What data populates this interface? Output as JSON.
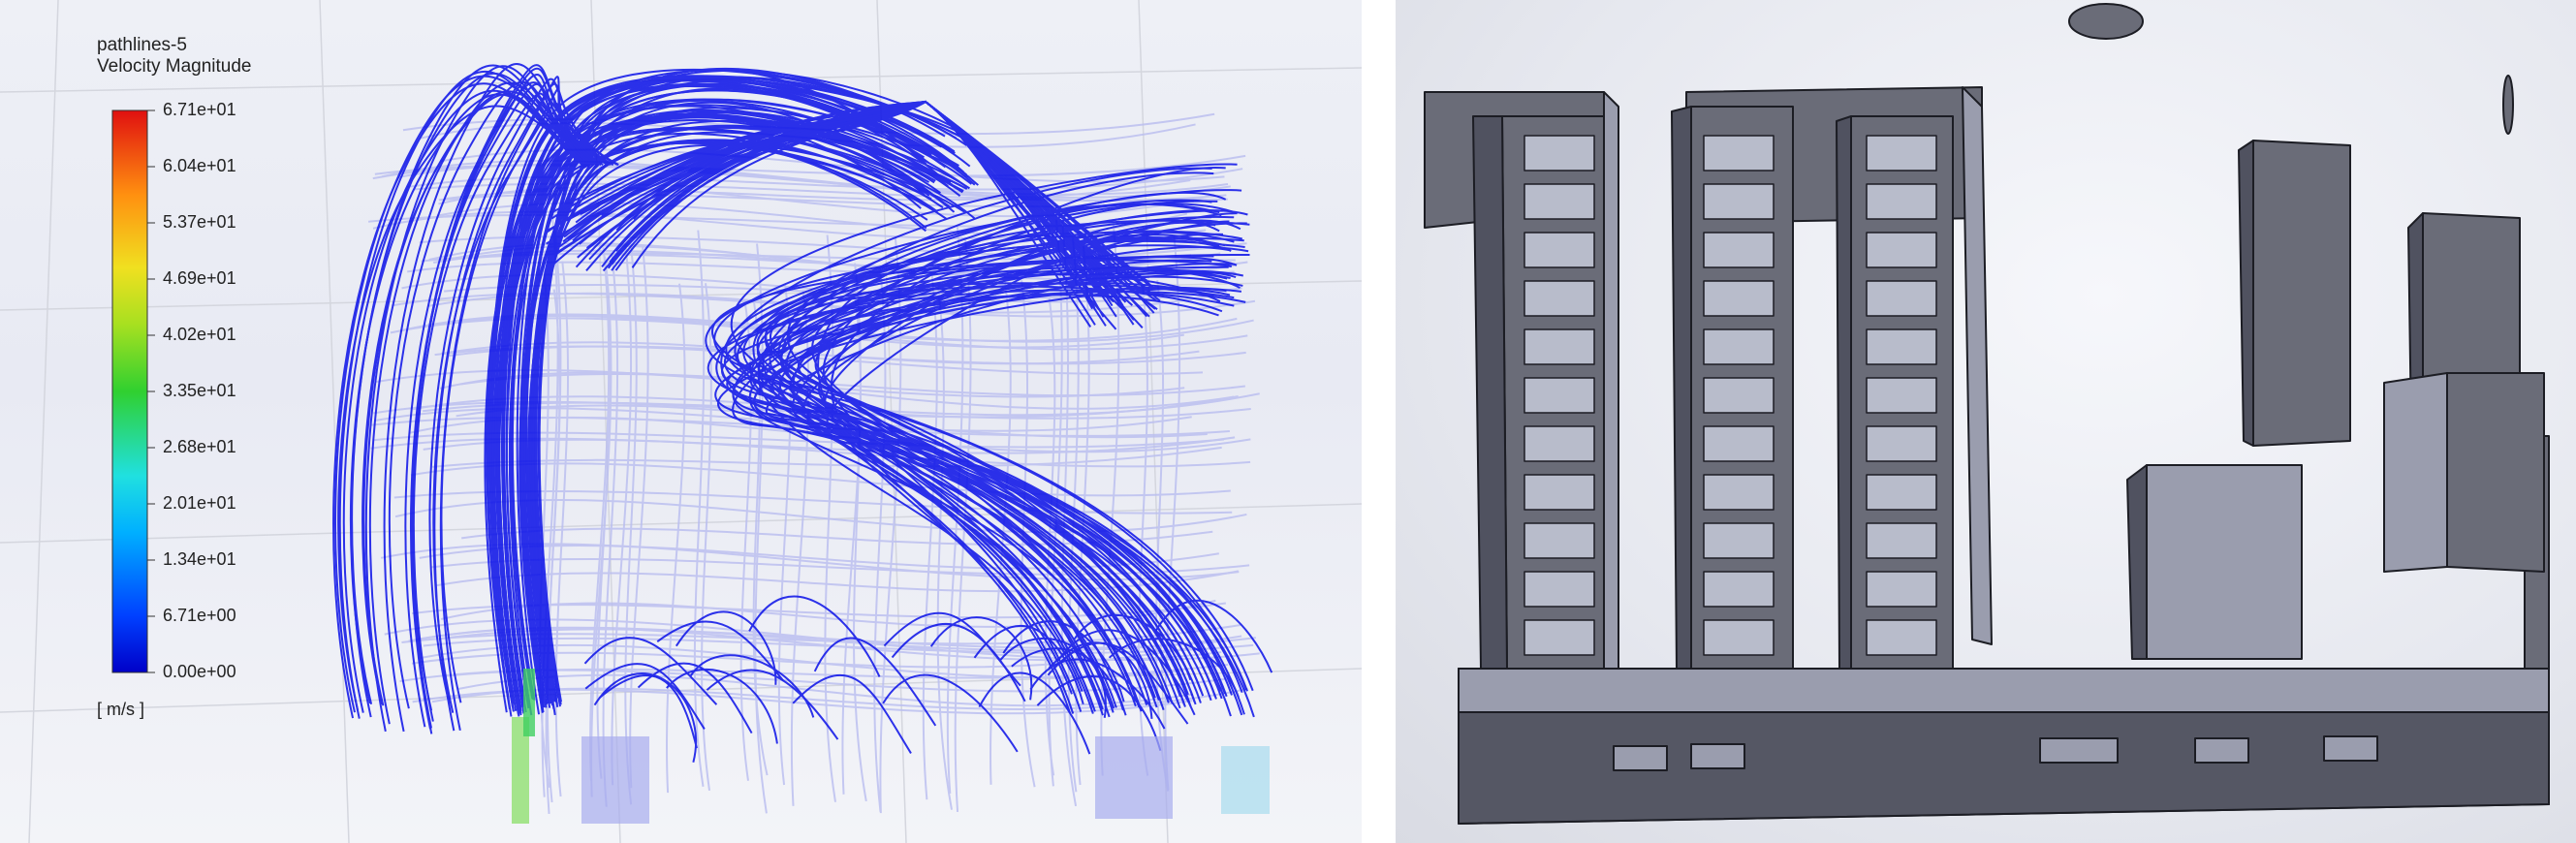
{
  "left_panel": {
    "legend": {
      "title": "pathlines-5",
      "subtitle": "Velocity Magnitude",
      "unit": "[ m/s ]",
      "ticks": [
        "6.71e+01",
        "6.04e+01",
        "5.37e+01",
        "4.69e+01",
        "4.02e+01",
        "3.35e+01",
        "2.68e+01",
        "2.01e+01",
        "1.34e+01",
        "6.71e+00",
        "0.00e+00"
      ]
    },
    "colors": {
      "low": "#0a10e8",
      "high": "#e82010",
      "faint": "#b9bdf0"
    }
  },
  "right_panel": {
    "colors": {
      "wall": "#6a6c78",
      "top": "#9a9dae",
      "edge": "#1c1d24",
      "panel": "#b8bccb"
    }
  }
}
